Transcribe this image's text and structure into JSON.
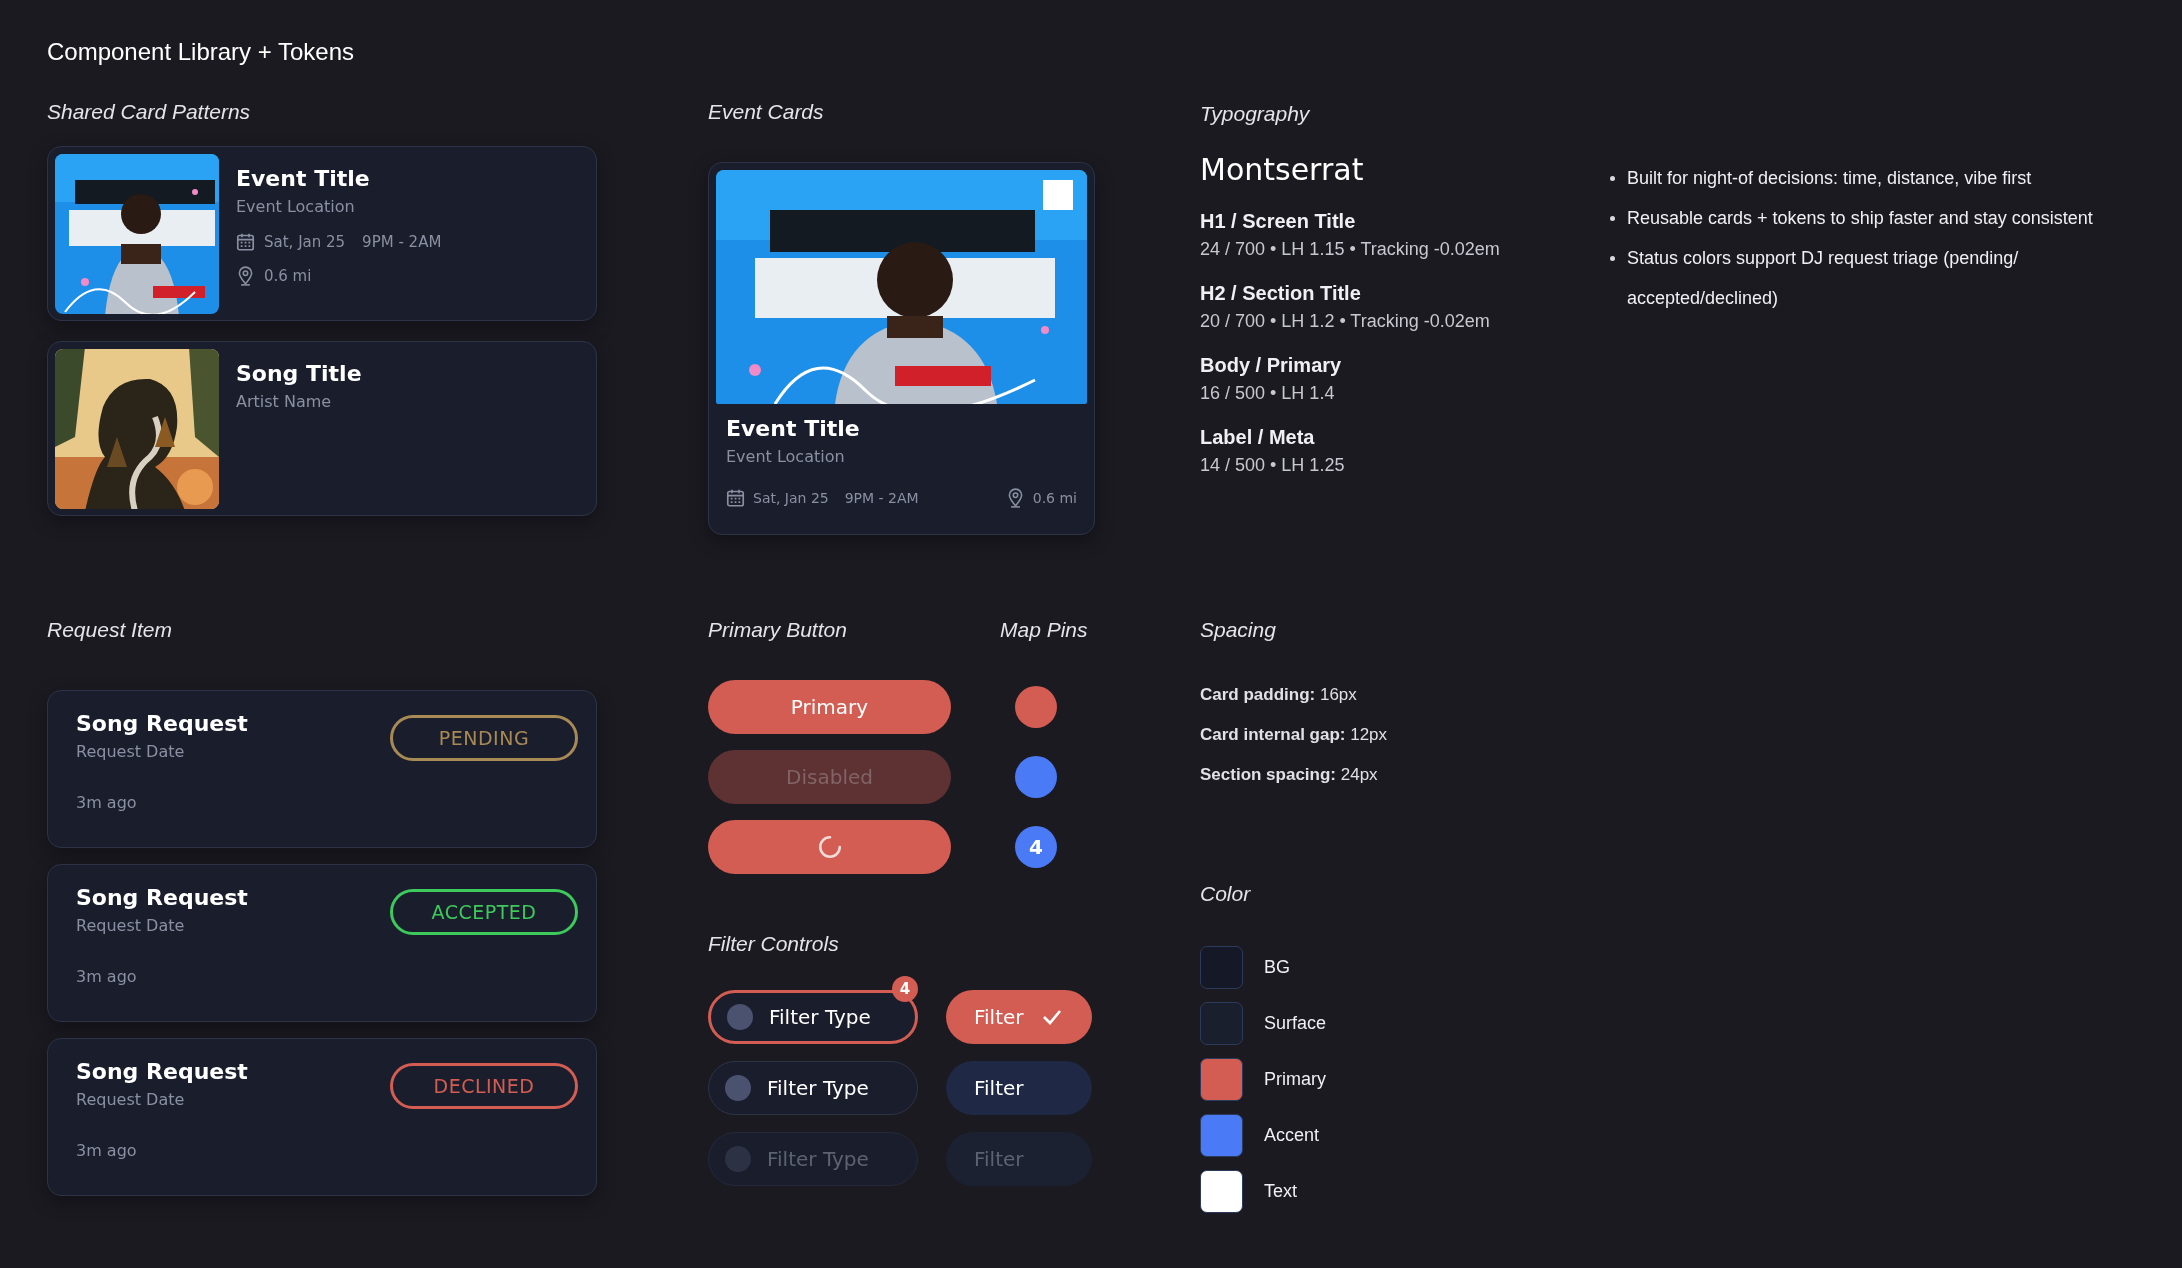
{
  "title": "Component Library + Tokens",
  "shared_card_patterns": {
    "heading": "Shared Card Patterns",
    "event_card": {
      "title": "Event Title",
      "location": "Event Location",
      "date": "Sat, Jan 25",
      "time": "9PM - 2AM",
      "distance": "0.6 mi"
    },
    "song_card": {
      "title": "Song Title",
      "artist": "Artist Name"
    }
  },
  "event_cards": {
    "heading": "Event Cards",
    "card": {
      "title": "Event Title",
      "location": "Event Location",
      "date": "Sat, Jan 25",
      "time": "9PM - 2AM",
      "distance": "0.6 mi"
    }
  },
  "typography": {
    "heading": "Typography",
    "font_name": "Montserrat",
    "styles": [
      {
        "name": "H1 / Screen Title",
        "spec": "24 / 700 • LH 1.15 • Tracking -0.02em"
      },
      {
        "name": "H2 / Section Title",
        "spec": "20 / 700 • LH 1.2 • Tracking -0.02em"
      },
      {
        "name": "Body / Primary",
        "spec": "16 / 500 • LH 1.4"
      },
      {
        "name": "Label / Meta",
        "spec": "14 / 500 • LH 1.25"
      }
    ]
  },
  "notes": [
    "Built for night-of decisions: time, distance, vibe first",
    "Reusable cards + tokens to ship faster and stay consistent",
    "Status colors support DJ request triage (pending/ accepted/declined)"
  ],
  "request_item": {
    "heading": "Request Item",
    "requests": [
      {
        "title": "Song Request",
        "date": "Request Date",
        "time_ago": "3m ago",
        "status": "PENDING",
        "color": "#a88a55"
      },
      {
        "title": "Song Request",
        "date": "Request Date",
        "time_ago": "3m ago",
        "status": "ACCEPTED",
        "color": "#3dc95b"
      },
      {
        "title": "Song Request",
        "date": "Request Date",
        "time_ago": "3m ago",
        "status": "DECLINED",
        "color": "#d35d52"
      }
    ]
  },
  "primary_button": {
    "heading": "Primary Button",
    "buttons": [
      {
        "kind": "text",
        "label": "Primary",
        "disabled": false
      },
      {
        "kind": "text",
        "label": "Disabled",
        "disabled": true
      },
      {
        "kind": "spinner",
        "disabled": false
      }
    ]
  },
  "map_pins": {
    "heading": "Map Pins",
    "pins": [
      {
        "color": "#d35d52"
      },
      {
        "color": "#4a7af5"
      },
      {
        "color": "#4a7af5",
        "count": "4"
      }
    ]
  },
  "filter_controls": {
    "heading": "Filter Controls",
    "chips": [
      {
        "label": "Filter Type",
        "selected": true,
        "disabled": false,
        "badge": "4"
      },
      {
        "label": "Filter Type",
        "selected": false,
        "disabled": false
      },
      {
        "label": "Filter Type",
        "selected": false,
        "disabled": true
      }
    ],
    "toggles": [
      {
        "label": "Filter",
        "selected": true,
        "disabled": false
      },
      {
        "label": "Filter",
        "selected": false,
        "disabled": false
      },
      {
        "label": "Filter",
        "selected": false,
        "disabled": true
      }
    ]
  },
  "spacing": {
    "heading": "Spacing",
    "tokens": [
      "**Card padding:** 16px",
      "**Card internal gap:** 12px",
      "**Section spacing:** 24px"
    ]
  },
  "color": {
    "heading": "Color",
    "swatches": [
      {
        "name": "BG",
        "color": "#151826"
      },
      {
        "name": "Surface",
        "color": "#1a1f2e"
      },
      {
        "name": "Primary",
        "color": "#d35d52"
      },
      {
        "name": "Accent",
        "color": "#4a7af5"
      },
      {
        "name": "Text",
        "color": "#ffffff"
      }
    ]
  }
}
